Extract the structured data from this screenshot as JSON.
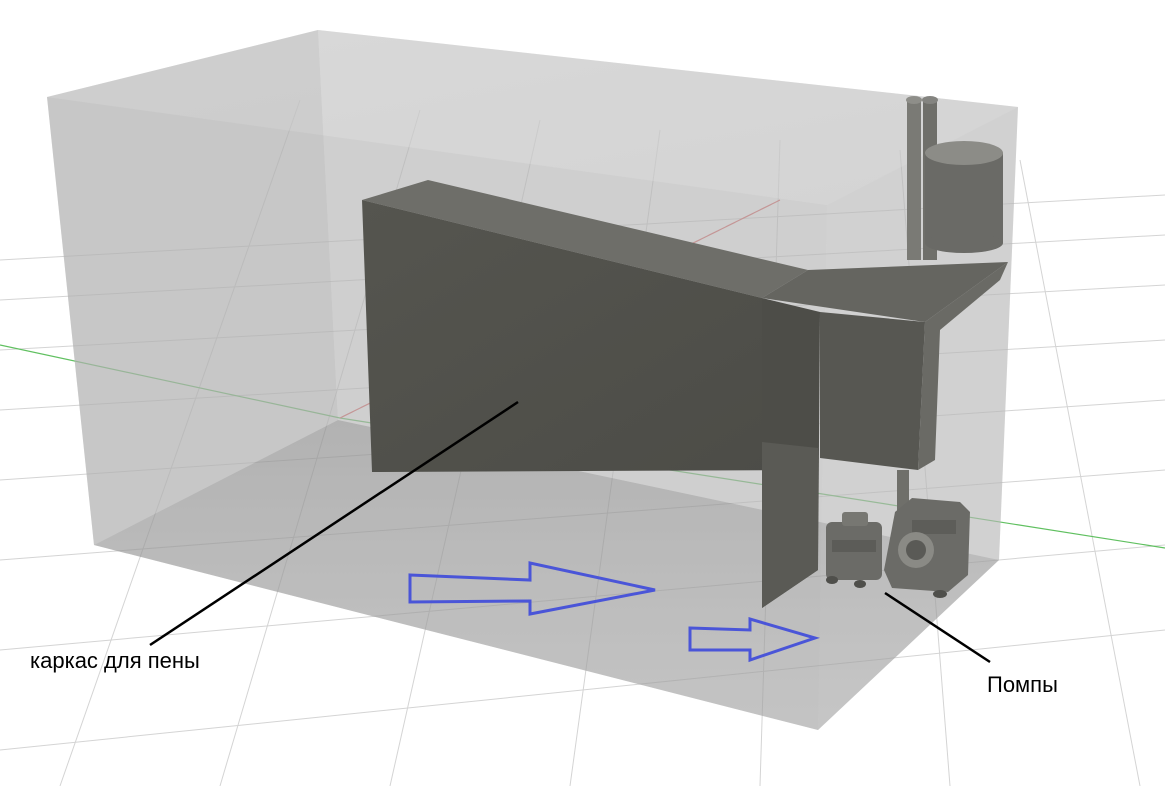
{
  "labels": {
    "frame": "каркас для пены",
    "pumps": "Помпы"
  },
  "colors": {
    "background": "#ffffff",
    "grid": "#d4d4d4",
    "axis_red": "#e06060",
    "axis_green": "#60c060",
    "glass_fill": "#9a9a9a",
    "frame_dark": "#5b5b57",
    "pump_grey": "#6d6d69",
    "arrow_blue": "#4a55d8",
    "leader_line": "#000000"
  },
  "icons": {
    "flow_arrow": "arrow-right-outline",
    "pump": "pump-shape"
  }
}
